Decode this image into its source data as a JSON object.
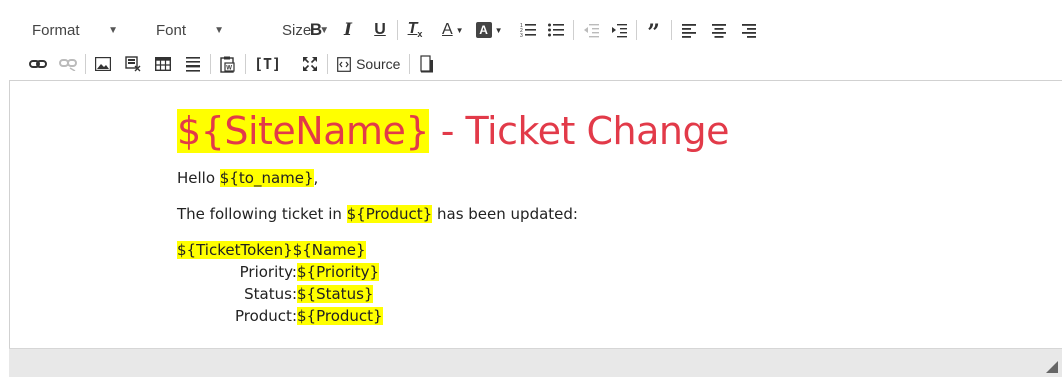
{
  "toolbar": {
    "format_label": "Format",
    "font_label": "Font",
    "size_label": "Size",
    "source_label": "Source",
    "icons": [
      "bold-icon",
      "italic-icon",
      "underline-icon",
      "remove-format-icon",
      "text-color-icon",
      "background-color-icon",
      "numbered-list-icon",
      "bulleted-list-icon",
      "outdent-icon",
      "indent-icon",
      "blockquote-icon",
      "align-left-icon",
      "align-center-icon",
      "align-right-icon",
      "link-icon",
      "unlink-icon",
      "image-icon",
      "flash-icon",
      "table-icon",
      "horizontal-line-icon",
      "paste-word-icon",
      "paste-text-icon",
      "maximize-icon",
      "source-icon",
      "show-blocks-icon"
    ]
  },
  "content": {
    "title_var": "${SiteName}",
    "title_rest": " - Ticket Change",
    "greeting_prefix": "Hello ",
    "greeting_var": "${to_name}",
    "greeting_suffix": ",",
    "intro_prefix": "The following ticket in ",
    "intro_var": "${Product}",
    "intro_suffix": " has been updated:",
    "ticket_token": "${TicketToken}",
    "ticket_name": "${Name}",
    "fields": [
      {
        "label": "Priority:",
        "value": "${Priority}"
      },
      {
        "label": "Status:",
        "value": "${Status}"
      },
      {
        "label": "Product:",
        "value": "${Product}"
      }
    ]
  },
  "colors": {
    "title_red": "#e23a49",
    "highlight": "#ffff00",
    "statusbar": "#e8e8e8"
  }
}
